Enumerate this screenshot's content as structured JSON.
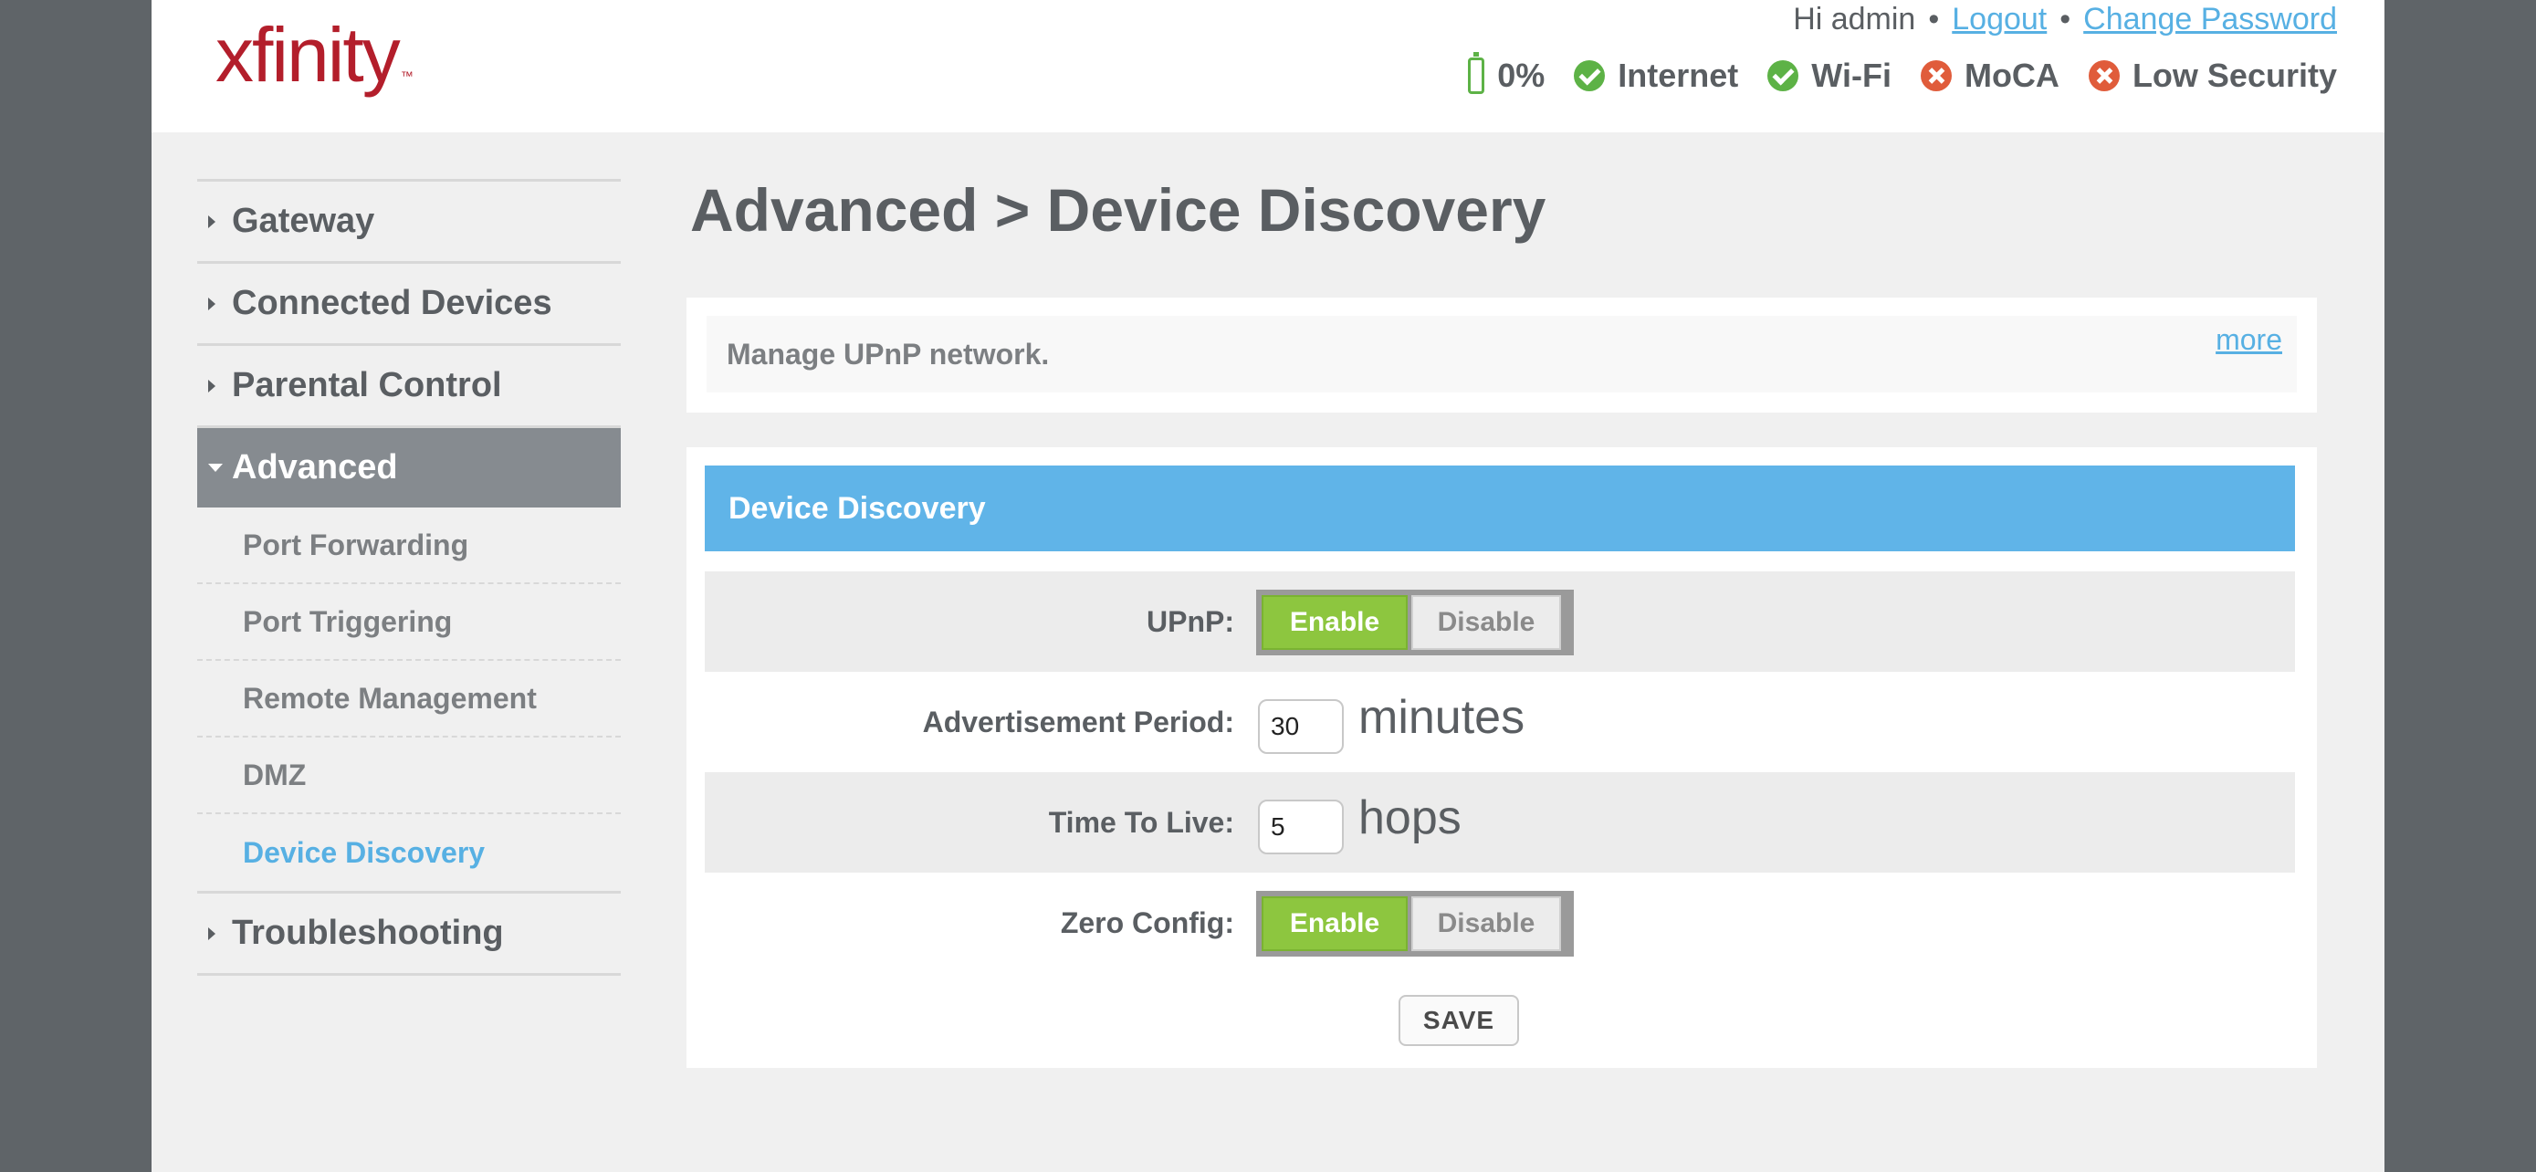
{
  "header": {
    "logo": "xfinity",
    "logo_tm": "™",
    "greeting": "Hi admin",
    "separator": "•",
    "logout": "Logout",
    "change_password": "Change Password",
    "status": {
      "battery": "0%",
      "internet": "Internet",
      "wifi": "Wi-Fi",
      "moca": "MoCA",
      "security": "Low Security"
    }
  },
  "sidebar": {
    "items": [
      {
        "label": "Gateway"
      },
      {
        "label": "Connected Devices"
      },
      {
        "label": "Parental Control"
      },
      {
        "label": "Advanced"
      },
      {
        "label": "Troubleshooting"
      }
    ],
    "advanced_sub": [
      {
        "label": "Port Forwarding"
      },
      {
        "label": "Port Triggering"
      },
      {
        "label": "Remote Management"
      },
      {
        "label": "DMZ"
      },
      {
        "label": "Device Discovery"
      }
    ]
  },
  "main": {
    "title": "Advanced > Device Discovery",
    "description": "Manage UPnP network.",
    "more": "more",
    "panel_title": "Device Discovery",
    "upnp_label": "UPnP:",
    "adv_period_label": "Advertisement Period:",
    "adv_period_value": "30",
    "adv_period_unit": "minutes",
    "ttl_label": "Time To Live:",
    "ttl_value": "5",
    "ttl_unit": "hops",
    "zero_config_label": "Zero Config:",
    "enable": "Enable",
    "disable": "Disable",
    "save": "SAVE"
  },
  "colors": {
    "brand_red": "#b31e2b",
    "accent_blue": "#60b4e8",
    "enable_green": "#8dc63f",
    "status_ok": "#5db246",
    "status_bad": "#e05c3b"
  }
}
